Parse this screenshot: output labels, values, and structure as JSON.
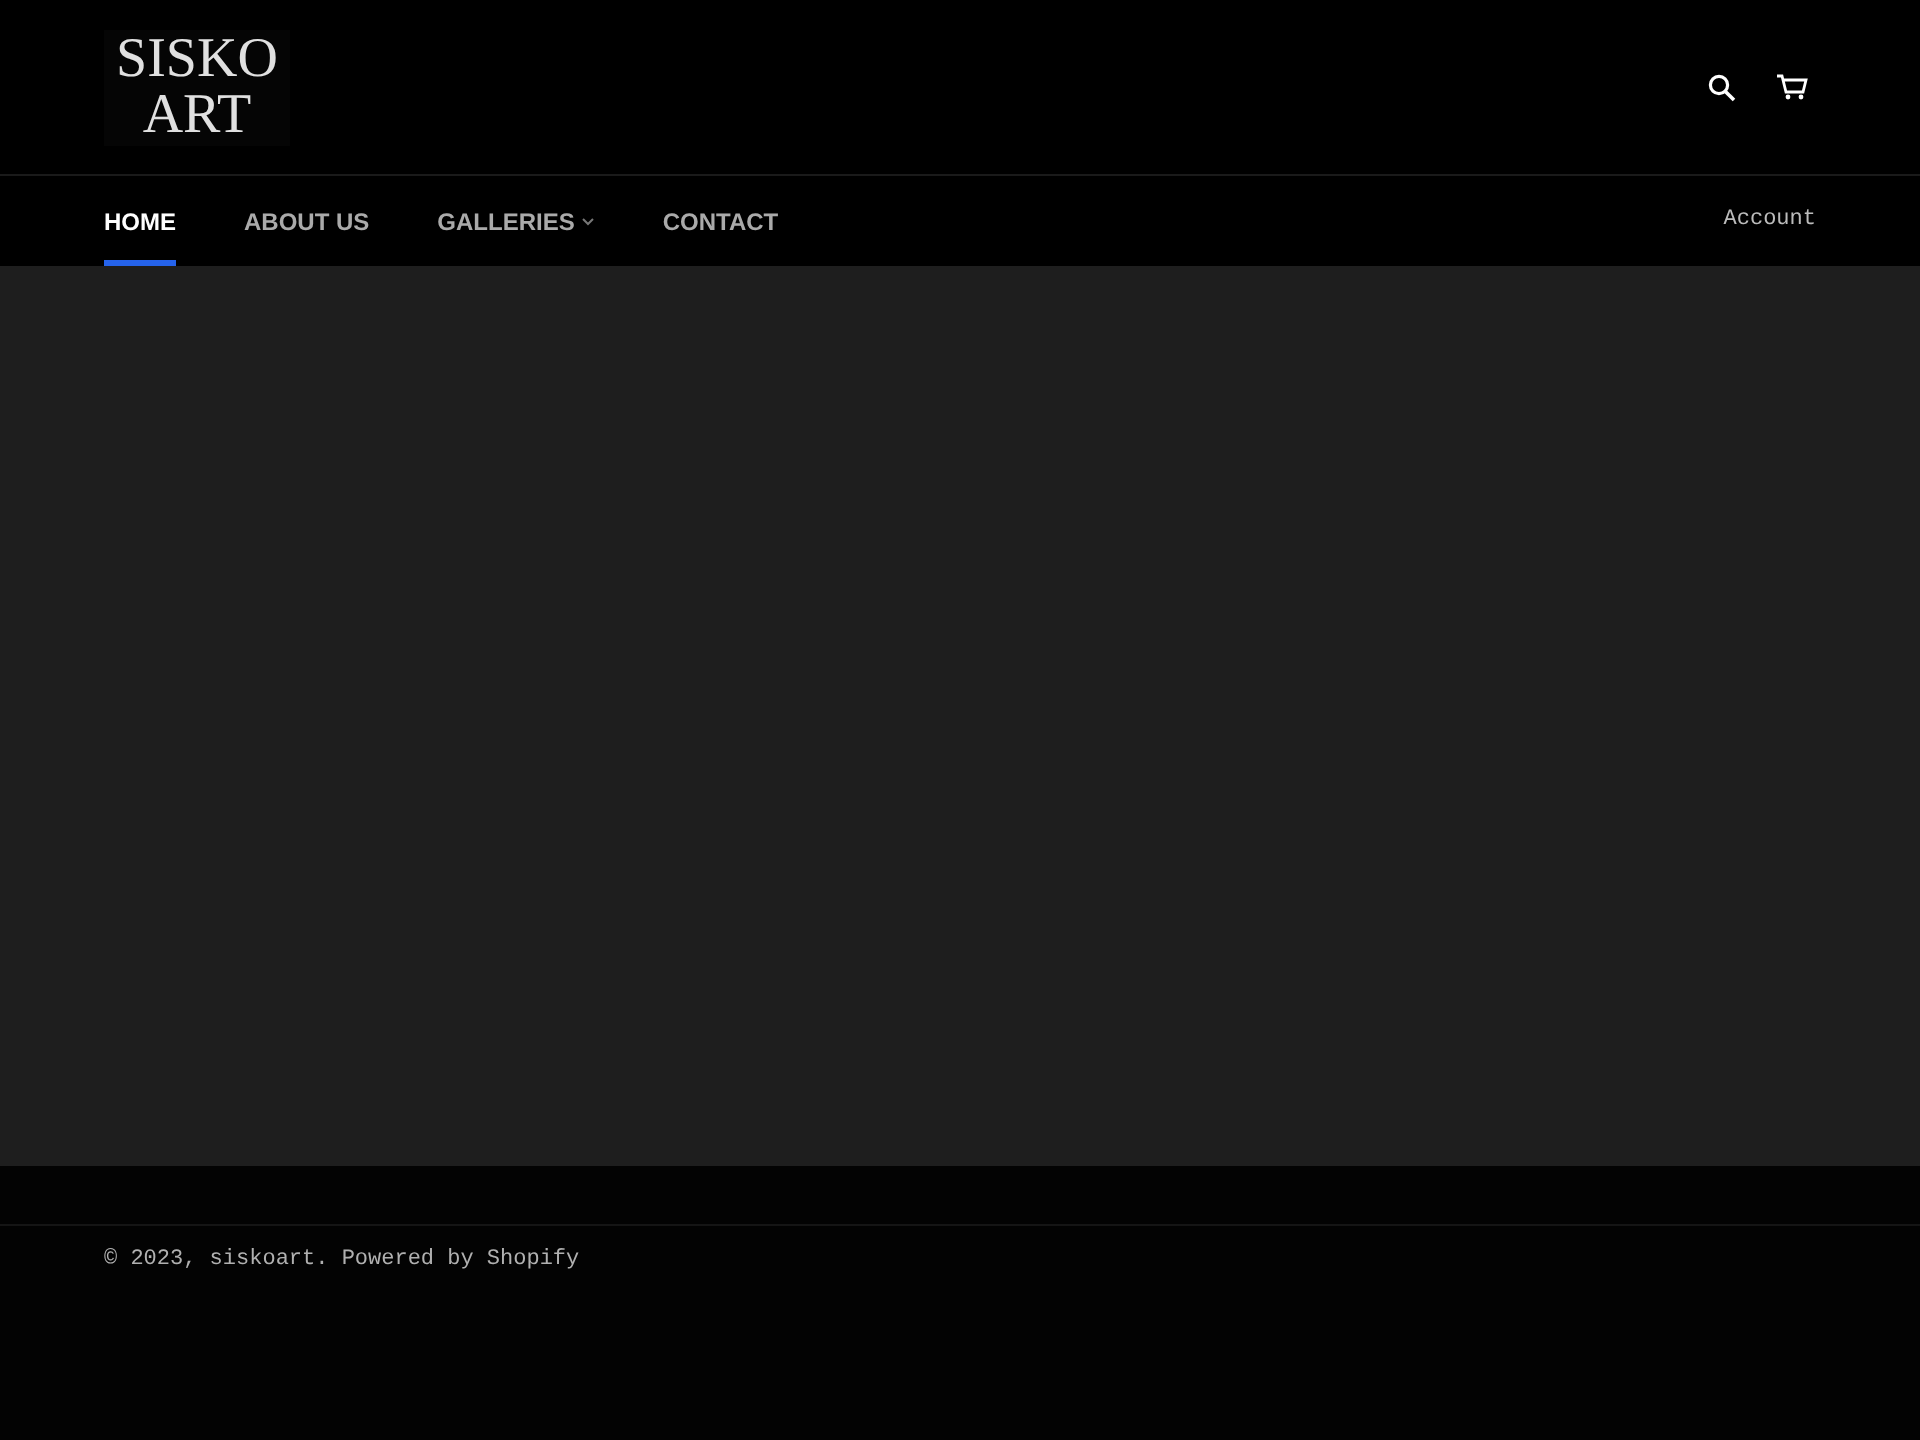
{
  "header": {
    "logo": [
      "SISKO",
      "ART"
    ],
    "account": "Account"
  },
  "nav": [
    {
      "label": "HOME",
      "selected": true,
      "dropdown": false
    },
    {
      "label": "ABOUT US",
      "selected": false,
      "dropdown": false
    },
    {
      "label": "GALLERIES",
      "selected": false,
      "dropdown": true
    },
    {
      "label": "CONTACT",
      "selected": false,
      "dropdown": false
    }
  ],
  "footer": {
    "copyright": "© 2023, siskoart. Powered by Shopify"
  }
}
